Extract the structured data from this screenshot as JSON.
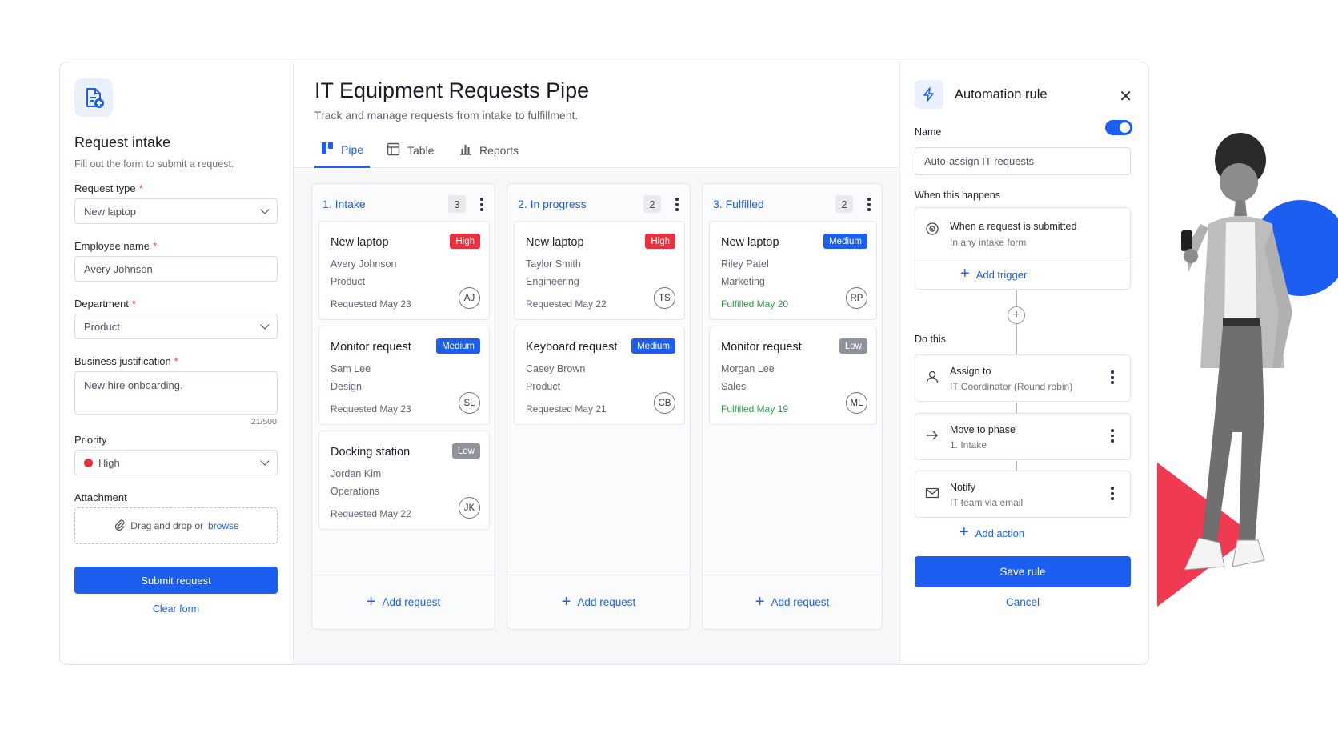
{
  "intake": {
    "title": "Request intake",
    "subtitle": "Fill out the form to submit a request.",
    "request_type_label": "Request type",
    "request_type_value": "New laptop",
    "employee_label": "Employee name",
    "employee_value": "Avery Johnson",
    "department_label": "Department",
    "department_value": "Product",
    "justification_label": "Business justification",
    "justification_value": "New hire onboarding.",
    "justification_counter": "21/500",
    "priority_label": "Priority",
    "priority_value": "High",
    "attachment_label": "Attachment",
    "attachment_text": "Drag and drop or",
    "attachment_link": "browse",
    "submit_label": "Submit request",
    "clear_label": "Clear form",
    "required_mark": "*"
  },
  "pipe": {
    "title": "IT Equipment Requests Pipe",
    "subtitle": "Track and manage requests from intake to fulfillment.",
    "tabs": [
      {
        "label": "Pipe",
        "icon": "kanban-icon"
      },
      {
        "label": "Table",
        "icon": "table-icon"
      },
      {
        "label": "Reports",
        "icon": "bar-chart-icon"
      }
    ],
    "add_request_label": "Add request",
    "columns": [
      {
        "title": "1.  Intake",
        "count": "3",
        "cards": [
          {
            "title": "New laptop",
            "priority": "High",
            "person": "Avery Johnson",
            "dept": "Product",
            "date": "Requested May 23",
            "initials": "AJ"
          },
          {
            "title": "Monitor request",
            "priority": "Medium",
            "person": "Sam Lee",
            "dept": "Design",
            "date": "Requested May 23",
            "initials": "SL"
          },
          {
            "title": "Docking station",
            "priority": "Low",
            "person": "Jordan Kim",
            "dept": "Operations",
            "date": "Requested May 22",
            "initials": "JK"
          }
        ]
      },
      {
        "title": "2.  In progress",
        "count": "2",
        "cards": [
          {
            "title": "New laptop",
            "priority": "High",
            "person": "Taylor Smith",
            "dept": "Engineering",
            "date": "Requested May 22",
            "initials": "TS"
          },
          {
            "title": "Keyboard request",
            "priority": "Medium",
            "person": "Casey Brown",
            "dept": "Product",
            "date": "Requested May 21",
            "initials": "CB"
          }
        ]
      },
      {
        "title": "3.  Fulfilled",
        "count": "2",
        "cards": [
          {
            "title": "New laptop",
            "priority": "Medium",
            "person": "Riley Patel",
            "dept": "Marketing",
            "date": "Fulfilled May 20",
            "initials": "RP"
          },
          {
            "title": "Monitor request",
            "priority": "Low",
            "person": "Morgan Lee",
            "dept": "Sales",
            "date": "Fulfilled May 19",
            "initials": "ML"
          }
        ]
      }
    ]
  },
  "automation": {
    "title": "Automation rule",
    "name_label": "Name",
    "name_value": "Auto-assign IT requests",
    "enabled": true,
    "when_label": "When this happens",
    "trigger_title": "When a request is submitted",
    "trigger_sub": "In any intake form",
    "add_trigger": "Add trigger",
    "do_label": "Do this",
    "actions": [
      {
        "title": "Assign to",
        "sub": "IT Coordinator (Round robin)",
        "icon": "user-icon"
      },
      {
        "title": "Move to phase",
        "sub": "1. Intake",
        "icon": "arrow-right-icon"
      },
      {
        "title": "Notify",
        "sub": "IT team via email",
        "icon": "mail-icon"
      }
    ],
    "add_action": "Add action",
    "save_label": "Save rule",
    "cancel_label": "Cancel"
  },
  "colors": {
    "accent": "#1c5ef0",
    "high": "#e8303f",
    "medium": "#1c5ef0",
    "low": "#8f949c",
    "fulfilled": "#2e9b48"
  }
}
